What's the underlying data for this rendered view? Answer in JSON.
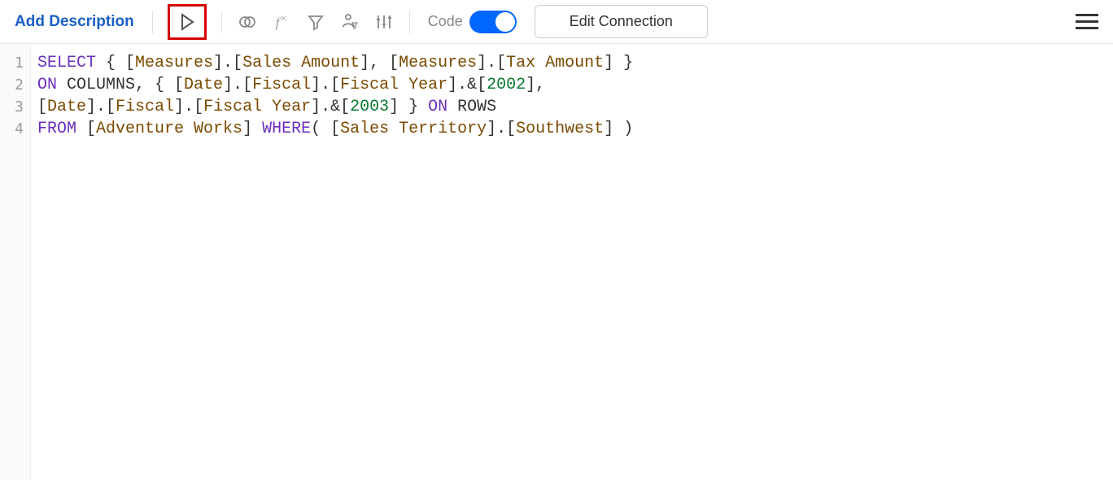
{
  "toolbar": {
    "add_description": "Add Description",
    "code_label": "Code",
    "edit_connection": "Edit Connection"
  },
  "code": {
    "line_numbers": [
      "1",
      "2",
      "3",
      "4"
    ],
    "lines": [
      {
        "tokens": [
          {
            "t": "SELECT",
            "c": "kw"
          },
          {
            "t": " { ["
          },
          {
            "t": "Measures",
            "c": "nm"
          },
          {
            "t": "].["
          },
          {
            "t": "Sales Amount",
            "c": "nm"
          },
          {
            "t": "], ["
          },
          {
            "t": "Measures",
            "c": "nm"
          },
          {
            "t": "].["
          },
          {
            "t": "Tax Amount",
            "c": "nm"
          },
          {
            "t": "] }"
          }
        ]
      },
      {
        "tokens": [
          {
            "t": "ON",
            "c": "kw"
          },
          {
            "t": " COLUMNS, { ["
          },
          {
            "t": "Date",
            "c": "nm"
          },
          {
            "t": "].["
          },
          {
            "t": "Fiscal",
            "c": "nm"
          },
          {
            "t": "].["
          },
          {
            "t": "Fiscal Year",
            "c": "nm"
          },
          {
            "t": "].&["
          },
          {
            "t": "2002",
            "c": "num"
          },
          {
            "t": "],"
          }
        ]
      },
      {
        "tokens": [
          {
            "t": "["
          },
          {
            "t": "Date",
            "c": "nm"
          },
          {
            "t": "].["
          },
          {
            "t": "Fiscal",
            "c": "nm"
          },
          {
            "t": "].["
          },
          {
            "t": "Fiscal Year",
            "c": "nm"
          },
          {
            "t": "].&["
          },
          {
            "t": "2003",
            "c": "num"
          },
          {
            "t": "] } "
          },
          {
            "t": "ON",
            "c": "kw"
          },
          {
            "t": " ROWS"
          }
        ]
      },
      {
        "tokens": [
          {
            "t": "FROM",
            "c": "kw"
          },
          {
            "t": " ["
          },
          {
            "t": "Adventure Works",
            "c": "nm"
          },
          {
            "t": "] "
          },
          {
            "t": "WHERE",
            "c": "kw"
          },
          {
            "t": "( ["
          },
          {
            "t": "Sales Territory",
            "c": "nm"
          },
          {
            "t": "].["
          },
          {
            "t": "Southwest",
            "c": "nm"
          },
          {
            "t": "] )"
          }
        ]
      }
    ]
  }
}
